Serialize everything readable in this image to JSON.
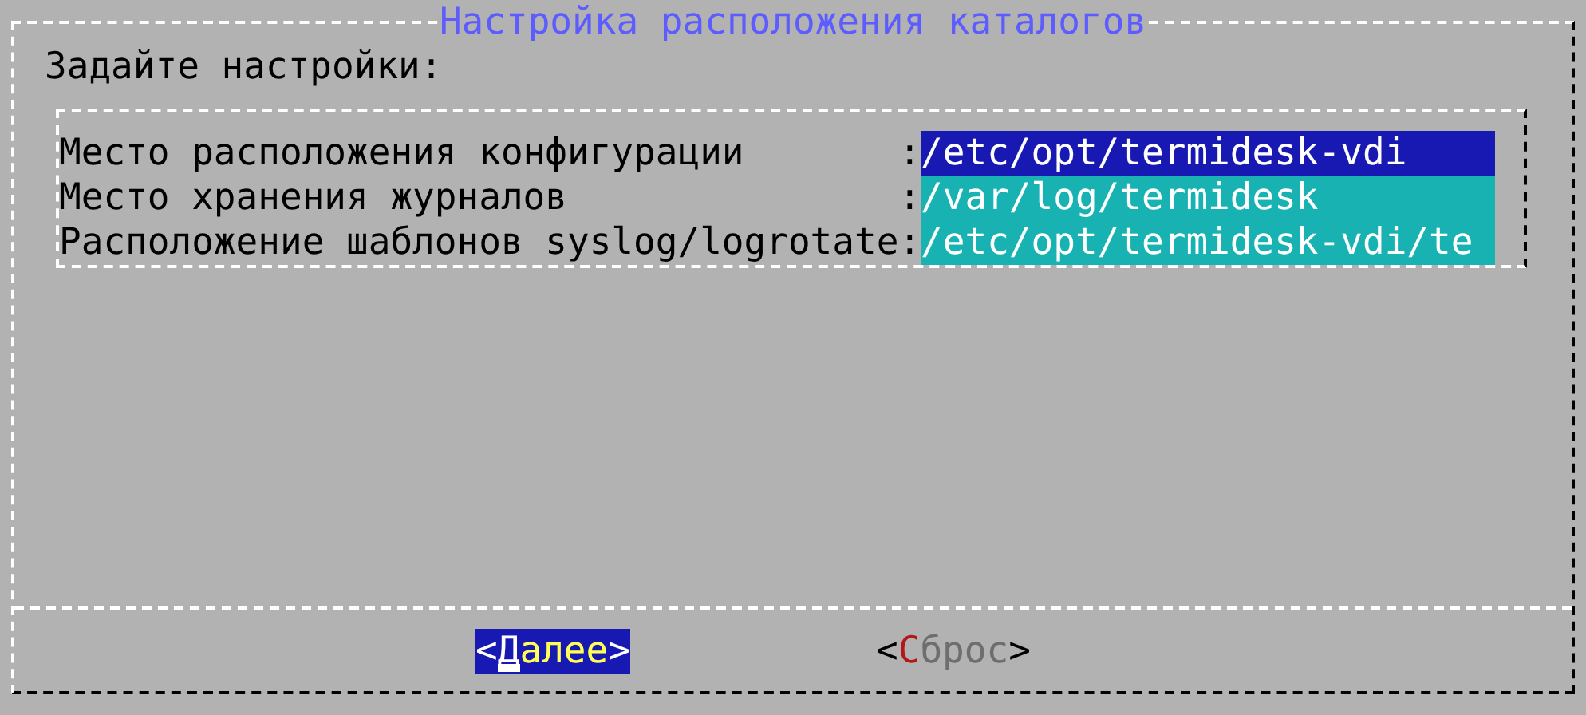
{
  "window": {
    "title": "Настройка расположения каталогов"
  },
  "instruction": "Задайте настройки:",
  "fields": [
    {
      "label": "Место расположения конфигурации",
      "separator": ":",
      "value": "/etc/opt/termidesk-vdi",
      "selected": true
    },
    {
      "label": "Место хранения журналов",
      "separator": ":",
      "value": "/var/log/termidesk",
      "selected": false
    },
    {
      "label": "Расположение шаблонов syslog/logrotate",
      "separator": ":",
      "value": "/etc/opt/termidesk-vdi/te",
      "selected": false
    }
  ],
  "buttons": [
    {
      "left_bracket": "<",
      "hotkey": "Д",
      "text": "алее",
      "right_bracket": ">",
      "selected": true
    },
    {
      "left_bracket": "<",
      "hotkey": "С",
      "text": "брос",
      "right_bracket": ">",
      "selected": false
    }
  ]
}
